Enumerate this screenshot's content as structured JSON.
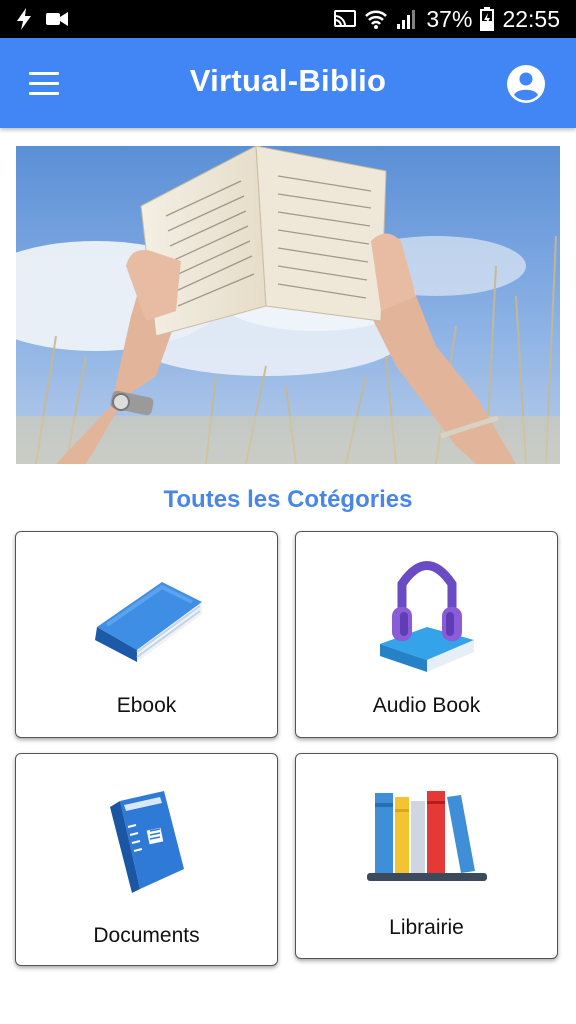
{
  "status_bar": {
    "battery_percent": "37%",
    "time": "22:55"
  },
  "app_bar": {
    "title": "Virtual-Biblio",
    "menu_icon": "hamburger-menu-icon",
    "account_icon": "account-circle-icon"
  },
  "hero": {
    "image": "hands-holding-open-book-against-sky"
  },
  "section": {
    "title": "Toutes les Cotégories"
  },
  "categories": [
    {
      "label": "Ebook",
      "icon": "blue-book-icon"
    },
    {
      "label": "Audio Book",
      "icon": "headphones-on-book-icon"
    },
    {
      "label": "Documents",
      "icon": "blue-document-binder-icon"
    },
    {
      "label": "Librairie",
      "icon": "books-on-shelf-icon"
    }
  ],
  "colors": {
    "app_bar": "#4285f4",
    "section_title": "#4a86e8",
    "status_bar": "#000000"
  }
}
